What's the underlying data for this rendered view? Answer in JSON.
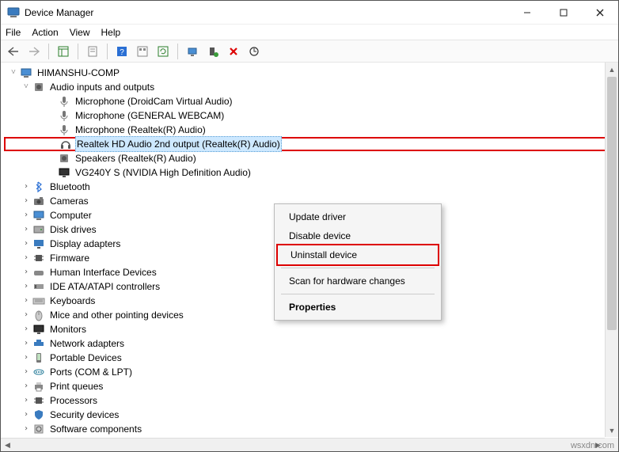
{
  "window": {
    "title": "Device Manager"
  },
  "menus": {
    "file": "File",
    "action": "Action",
    "view": "View",
    "help": "Help"
  },
  "toolbar_icons": {
    "back": "back-icon",
    "forward": "forward-icon",
    "show_hide": "show-hide-tree-icon",
    "properties": "properties-icon",
    "help": "help-icon",
    "group": "group-icon",
    "refresh": "refresh-icon",
    "monitor": "monitor-icon",
    "device_enable": "device-enable-icon",
    "remove": "remove-icon",
    "scan": "scan-hardware-icon"
  },
  "tree": {
    "root": "HIMANSHU-COMP",
    "audio_category": "Audio inputs and outputs",
    "audio_items": [
      "Microphone (DroidCam Virtual Audio)",
      "Microphone (GENERAL WEBCAM)",
      "Microphone (Realtek(R) Audio)",
      "Realtek HD Audio 2nd output (Realtek(R) Audio)",
      "Speakers (Realtek(R) Audio)",
      "VG240Y S (NVIDIA High Definition Audio)"
    ],
    "selected_audio_index": 3,
    "categories": [
      "Bluetooth",
      "Cameras",
      "Computer",
      "Disk drives",
      "Display adapters",
      "Firmware",
      "Human Interface Devices",
      "IDE ATA/ATAPI controllers",
      "Keyboards",
      "Mice and other pointing devices",
      "Monitors",
      "Network adapters",
      "Portable Devices",
      "Ports (COM & LPT)",
      "Print queues",
      "Processors",
      "Security devices",
      "Software components"
    ]
  },
  "context_menu": {
    "update_driver": "Update driver",
    "disable_device": "Disable device",
    "uninstall_device": "Uninstall device",
    "scan_hw": "Scan for hardware changes",
    "properties": "Properties"
  },
  "watermark": "wsxdn.com"
}
